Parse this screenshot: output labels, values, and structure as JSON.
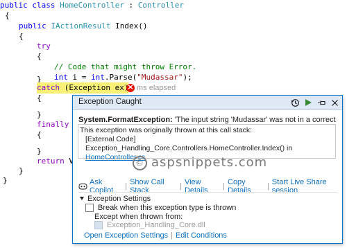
{
  "code": {
    "line1": {
      "kw1": "public",
      "kw2": "class",
      "name": "HomeController",
      "colon": ":",
      "base": "Controller"
    },
    "line2": "{",
    "line3": {
      "kw": "public",
      "type": "IActionResult",
      "name": "Index()"
    },
    "line4": "{",
    "line5": "try",
    "line6": "{",
    "line7": "// Code that might throw Error.",
    "line8": {
      "kw": "int",
      "var": "i",
      "eq": "=",
      "kw2": "int",
      "call": ".Parse(",
      "str": "\"Mudassar\"",
      "end": ");"
    },
    "line9": "}",
    "line10": {
      "kw": "catch",
      "rest": "(Exception ex)"
    },
    "line11": "{",
    "line12": "}",
    "line13": "finally",
    "line14": "{",
    "line15": "}",
    "line16": {
      "kw": "return",
      "rest": "V"
    },
    "line17": "}",
    "line18": "}",
    "elapsed": "ms elapsed"
  },
  "popup": {
    "title": "Exception Caught",
    "exception_type": "System.FormatException:",
    "exception_message": "'The input string 'Mudassar' was not in a correct format.'",
    "stack_intro": "This exception was originally thrown at this call stack:",
    "stack_frame1": "[External Code]",
    "stack_frame2": "Exception_Handling_Core.Controllers.HomeController.Index() in",
    "stack_link": "HomeController.cs",
    "watermark": "aspsnippets.com",
    "watermark_symbol": "©",
    "actions": {
      "ask_copilot": "Ask Copilot",
      "show_call_stack": "Show Call Stack",
      "view_details": "View Details",
      "copy_details": "Copy Details",
      "live_share": "Start Live Share session"
    },
    "settings_heading": "Exception Settings",
    "break_label": "Break when this exception type is thrown",
    "except_label": "Except when thrown from:",
    "module_label": "Exception_Handling_Core.dll",
    "open_settings": "Open Exception Settings",
    "edit_conditions": "Edit Conditions"
  },
  "colors": {
    "keyword": "#0000ff",
    "type": "#2b91af",
    "control_keyword": "#8f08c4",
    "comment": "#008000",
    "string": "#a31515",
    "highlight": "#f8f176",
    "link": "#0e70c0",
    "popup_border": "#0e70c0"
  },
  "icons": [
    "history-icon",
    "continue-icon",
    "pin-icon",
    "close-icon",
    "copilot-icon"
  ]
}
